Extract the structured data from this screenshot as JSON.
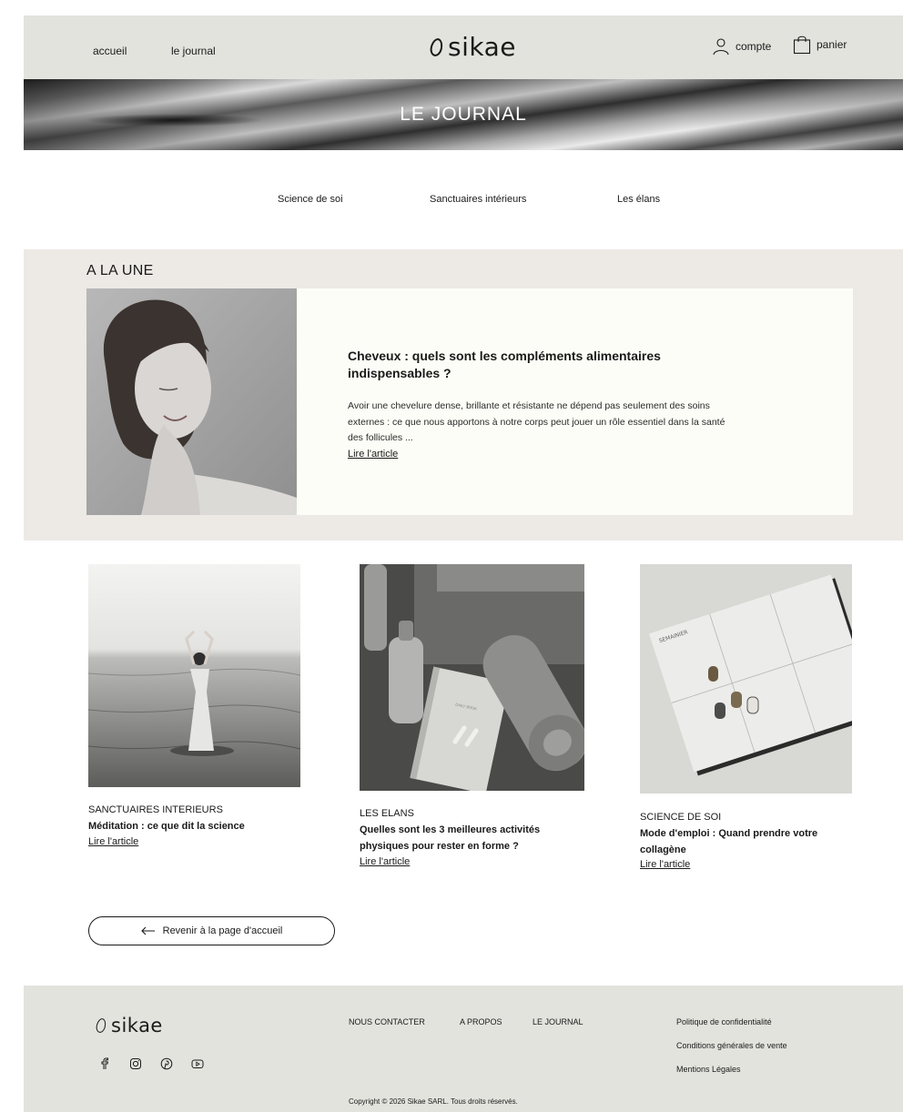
{
  "header": {
    "nav": [
      "accueil",
      "le journal"
    ],
    "brand": "sikae",
    "account_label": "compte",
    "cart_label": "panier"
  },
  "banner": {
    "title": "LE JOURNAL"
  },
  "categories": [
    "Science de soi",
    "Sanctuaires intérieurs",
    "Les élans"
  ],
  "featured": {
    "section_title": "A LA UNE",
    "title": "Cheveux : quels sont les compléments alimentaires indispensables ?",
    "excerpt": "Avoir une chevelure dense, brillante et résistante ne dépend pas seulement des soins externes : ce que nous apportons à notre corps peut jouer un rôle essentiel dans la santé des follicules ...",
    "link": "Lire l'article"
  },
  "articles": [
    {
      "category": "SANCTUAIRES INTERIEURS",
      "title": "Méditation : ce que dit la science",
      "link": "Lire l'article"
    },
    {
      "category": "LES ELANS",
      "title": "Quelles sont les 3 meilleures activités physiques pour rester en forme ?",
      "link": "Lire l'article"
    },
    {
      "category": "SCIENCE DE SOI",
      "title": "Mode d'emploi :  Quand prendre votre collagène",
      "link": "Lire l'article"
    }
  ],
  "back_button": {
    "label": "Revenir à la page d'accueil"
  },
  "footer": {
    "brand": "sikae",
    "social": [
      "facebook-icon",
      "instagram-icon",
      "pinterest-icon",
      "youtube-icon"
    ],
    "links": [
      "NOUS CONTACTER",
      "A PROPOS",
      "LE JOURNAL"
    ],
    "legal": [
      "Politique de confidentialité",
      "Conditions générales de vente",
      "Mentions Légales"
    ],
    "copyright": "Copyright © 2026 Sikae SARL. Tous droits réservés."
  }
}
